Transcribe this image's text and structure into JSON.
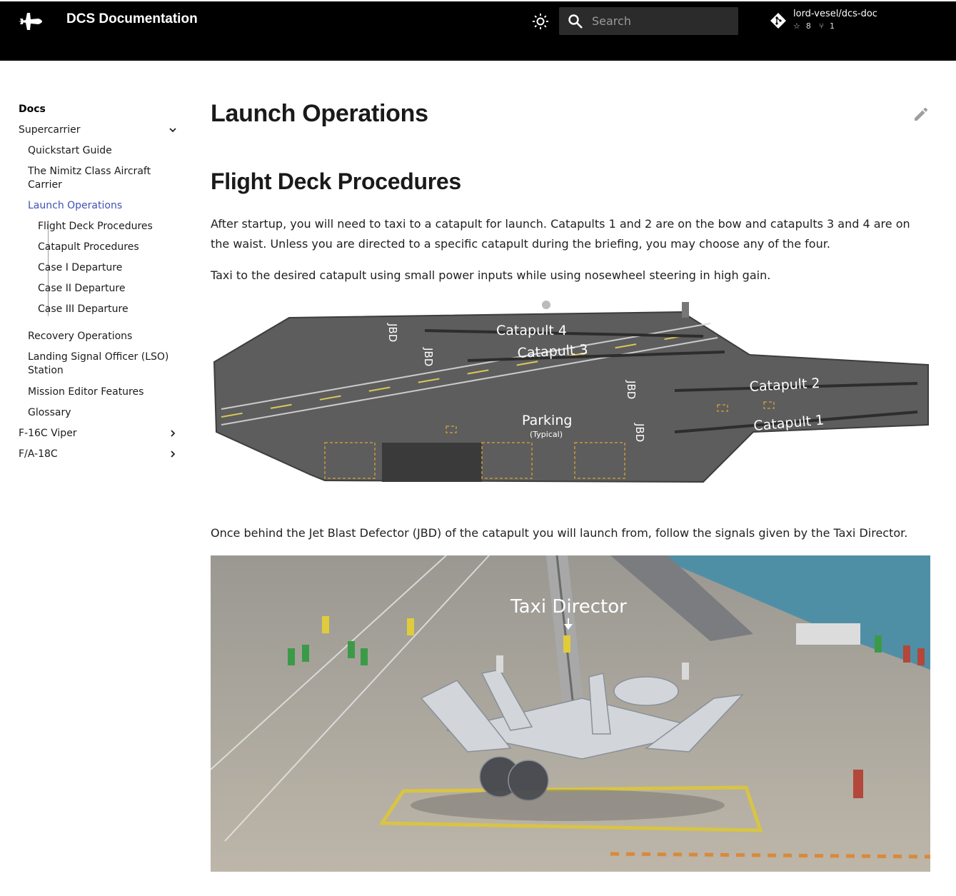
{
  "header": {
    "site_title": "DCS Documentation",
    "search_placeholder": "Search",
    "repo": {
      "name": "lord-vesel/dcs-doc",
      "stars": "8",
      "forks": "1"
    }
  },
  "sidebar": {
    "title": "Docs",
    "items": [
      {
        "label": "Supercarrier",
        "expanded": true
      },
      {
        "label": "Quickstart Guide"
      },
      {
        "label": "The Nimitz Class Aircraft Carrier"
      },
      {
        "label": "Launch Operations",
        "active": true
      },
      {
        "label": "Flight Deck Procedures"
      },
      {
        "label": "Catapult Procedures"
      },
      {
        "label": "Case I Departure"
      },
      {
        "label": "Case II Departure"
      },
      {
        "label": "Case III Departure"
      },
      {
        "label": "Recovery Operations"
      },
      {
        "label": "Landing Signal Officer (LSO) Station"
      },
      {
        "label": "Mission Editor Features"
      },
      {
        "label": "Glossary"
      },
      {
        "label": "F-16C Viper",
        "expanded": false
      },
      {
        "label": "F/A-18C",
        "expanded": false
      }
    ]
  },
  "content": {
    "title": "Launch Operations",
    "section_title": "Flight Deck Procedures",
    "paragraphs": [
      "After startup, you will need to taxi to a catapult for launch. Catapults 1 and 2 are on the bow and catapults 3 and 4 are on the waist. Unless you are directed to a specific catapult during the briefing, you may choose any of the four.",
      "Taxi to the desired catapult using small power inputs while using nosewheel steering in high gain.",
      "Once behind the Jet Blast Defector (JBD) of the catapult you will launch from, follow the signals given by the Taxi Director."
    ],
    "deck_figure": {
      "labels": {
        "cat4": "Catapult 4",
        "cat3": "Catapult 3",
        "cat2": "Catapult 2",
        "cat1": "Catapult 1",
        "parking": "Parking",
        "parking_sub": "(Typical)",
        "jbd": "JBD"
      }
    },
    "photo_figure": {
      "label": "Taxi Director"
    }
  },
  "colors": {
    "header_bg": "#000000",
    "accent": "#3f51b5",
    "deck": "#5a5a5a",
    "sea": "#4f8fa6"
  }
}
